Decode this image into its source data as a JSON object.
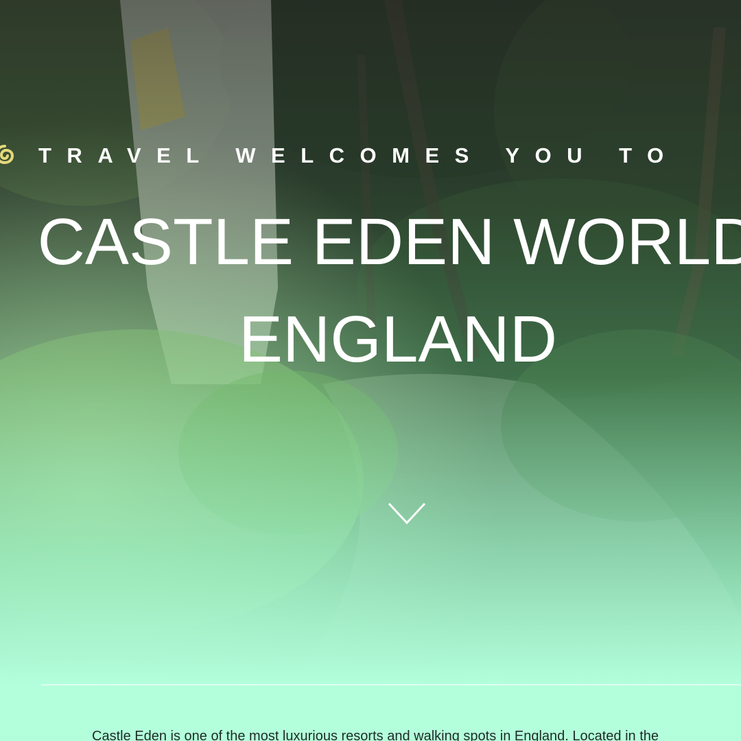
{
  "hero": {
    "tagline_line": "TRAVEL WELCOMES YOU TO",
    "title_line1": "CASTLE EDEN WORLD",
    "title_line2": "ENGLAND",
    "logo_icon": "snail-logo-icon",
    "scroll_icon": "chevron-down-icon"
  },
  "intro": {
    "text": "Castle Eden is one of the most luxurious resorts and walking spots in England. Located in the"
  },
  "colors": {
    "page_bg": "#b3ffdc",
    "text_light": "#ffffff",
    "text_dark": "#1d2b24",
    "logo_fill": "#e6d97a"
  }
}
